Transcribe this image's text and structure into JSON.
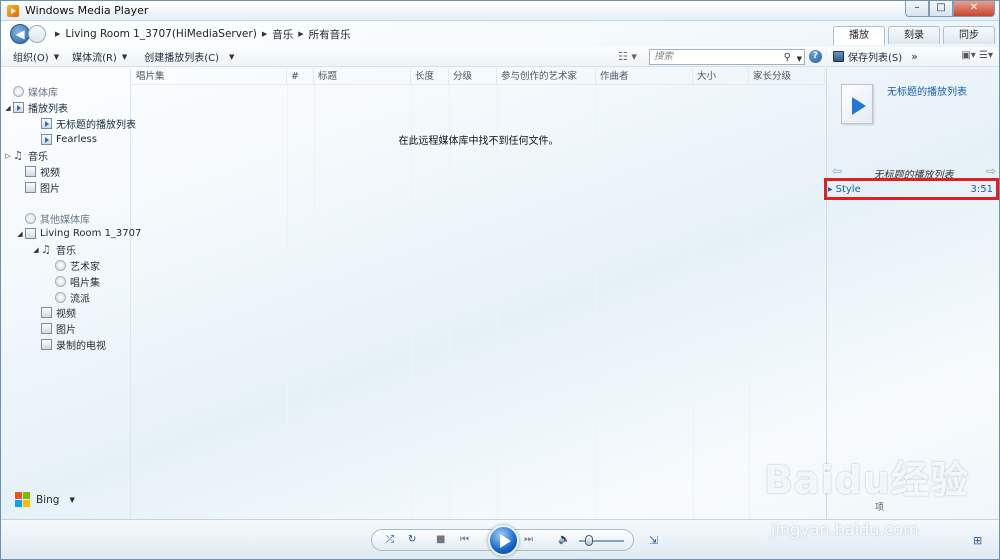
{
  "window": {
    "title": "Windows Media Player",
    "min": "–",
    "max": "□",
    "close": "✕"
  },
  "breadcrumb": {
    "server": "Living Room 1_3707(HiMediaServer)",
    "category": "音乐",
    "view": "所有音乐"
  },
  "tabs": [
    {
      "label": "播放"
    },
    {
      "label": "刻录"
    },
    {
      "label": "同步"
    }
  ],
  "toolbar": {
    "organize": "组织(O)",
    "stream": "媒体流(R)",
    "create_playlist": "创建播放列表(C)",
    "search_placeholder": "搜索"
  },
  "right_toolbar": {
    "save_list": "保存列表(S)",
    "more": "»"
  },
  "sidebar": {
    "library": "媒体库",
    "playlists": "播放列表",
    "playlist_1": "无标题的播放列表",
    "playlist_2": "Fearless",
    "music": "音乐",
    "video": "视频",
    "pictures": "图片",
    "other_libraries": "其他媒体库",
    "remote": "Living Room 1_3707",
    "remote_music": "音乐",
    "artists": "艺术家",
    "albums": "唱片集",
    "genres": "流派",
    "remote_video": "视频",
    "remote_pictures": "图片",
    "recorded_tv": "录制的电视"
  },
  "columns": [
    "唱片集",
    "#",
    "标题",
    "长度",
    "分级",
    "参与创作的艺术家",
    "作曲者",
    "大小",
    "家长分级"
  ],
  "empty_message": "在此远程媒体库中找不到任何文件。",
  "bing": {
    "label": "Bing"
  },
  "playlist_panel": {
    "title": "无标题的播放列表",
    "nav_name": "无标题的播放列表",
    "tracks": [
      {
        "name": "Style",
        "duration": "3:51"
      }
    ],
    "footer": "项"
  },
  "watermark": {
    "logo": "Baidu经验",
    "url": "jingyan.baidu.com"
  },
  "colors": {
    "accent": "#1a5fb4",
    "highlight_border": "#e02020"
  }
}
